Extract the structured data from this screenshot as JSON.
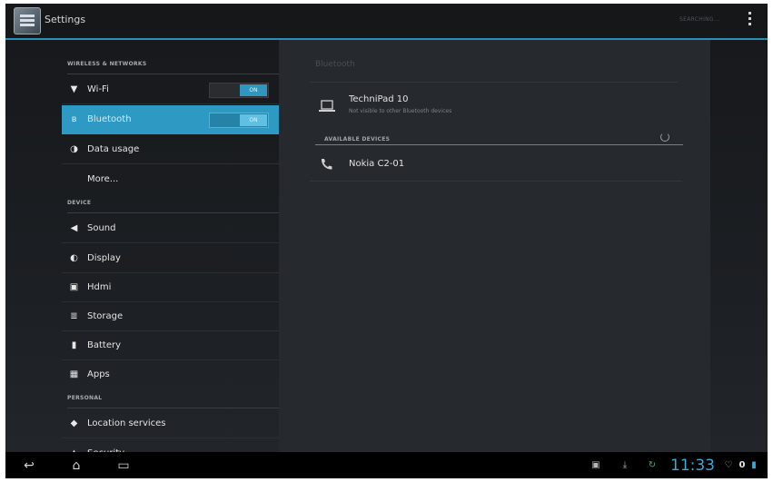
{
  "action_bar": {
    "title": "Settings",
    "search_hint": "SEARCHING..."
  },
  "left_pane": {
    "sections": [
      {
        "header": "WIRELESS & NETWORKS",
        "items": [
          {
            "label": "Wi-Fi",
            "icon": "wifi-icon",
            "toggle": "ON"
          },
          {
            "label": "Bluetooth",
            "icon": "bluetooth-icon",
            "toggle": "ON",
            "selected": true
          },
          {
            "label": "Data usage",
            "icon": "data-usage-icon"
          },
          {
            "label": "More..."
          }
        ]
      },
      {
        "header": "DEVICE",
        "items": [
          {
            "label": "Sound",
            "icon": "speaker-icon"
          },
          {
            "label": "Display",
            "icon": "display-icon"
          },
          {
            "label": "Hdmi",
            "icon": "hdmi-icon"
          },
          {
            "label": "Storage",
            "icon": "storage-icon"
          },
          {
            "label": "Battery",
            "icon": "battery-icon"
          },
          {
            "label": "Apps",
            "icon": "apps-icon"
          }
        ]
      },
      {
        "header": "PERSONAL",
        "items": [
          {
            "label": "Location services",
            "icon": "location-icon"
          },
          {
            "label": "Security",
            "icon": "lock-icon"
          }
        ]
      }
    ]
  },
  "right_pane": {
    "title": "Bluetooth",
    "this_device": {
      "name": "TechniPad 10",
      "subtitle": "Not visible to other Bluetooth devices",
      "icon": "laptop-icon"
    },
    "available_header": "AVAILABLE DEVICES",
    "available_devices": [
      {
        "name": "Nokia C2-01",
        "icon": "phone-icon"
      }
    ]
  },
  "nav_bar": {
    "clock": "11:33",
    "accent": "#3ea8d8"
  },
  "colors": {
    "selection": "#2e9ac4",
    "actionbar_rule": "#2a8fb5"
  }
}
